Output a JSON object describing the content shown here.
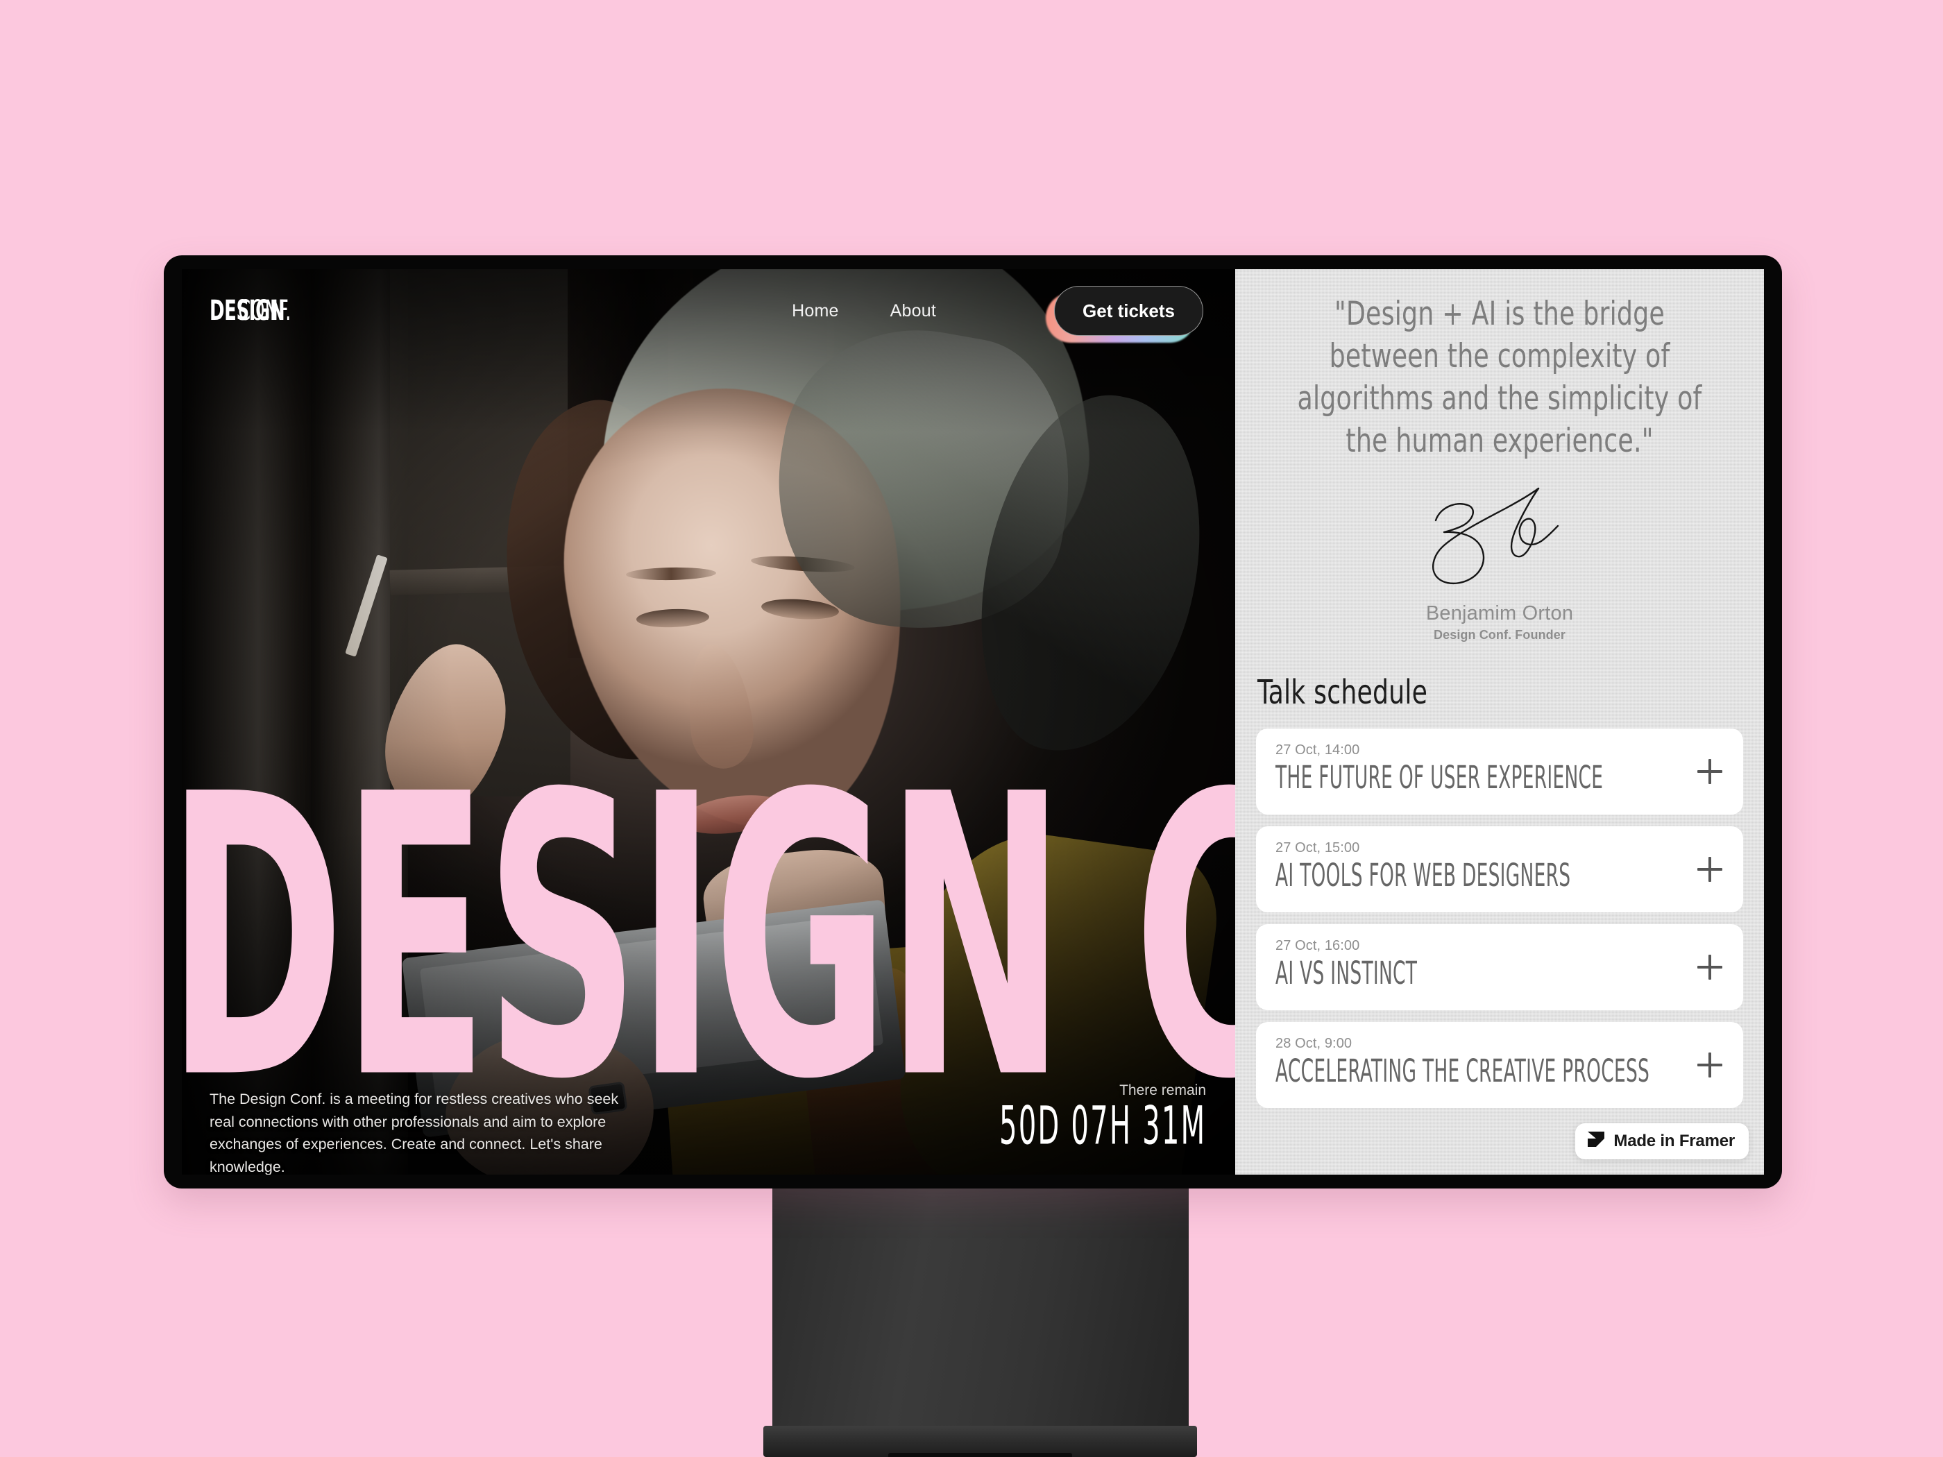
{
  "page": {
    "background_color": "#fcc8de",
    "accent_pink": "#fbc9e0",
    "panel_color": "#dfdfdf"
  },
  "hero": {
    "brand": {
      "bold_part": "DESIGN",
      "light_part": "CONF."
    },
    "nav": [
      {
        "label": "Home"
      },
      {
        "label": "About"
      }
    ],
    "cta": {
      "label": "Get tickets",
      "gradient": "#f58f7c → #c9a8e8 → #86dcc8"
    },
    "headline": "DESIGN CONF",
    "description": "The Design Conf. is a meeting for restless creatives who seek real connections with other professionals and aim to explore exchanges of experiences. Create and connect. Let's share knowledge.",
    "countdown": {
      "label": "There remain",
      "value": "50D 07H 31M"
    }
  },
  "panel": {
    "quote": "\"Design + AI is the bridge between the complexity of algorithms and the simplicity of the human experience.\"",
    "signature": {
      "name": "Benjamim Orton",
      "role": "Design Conf. Founder"
    },
    "schedule": {
      "title": "Talk schedule",
      "items": [
        {
          "date": "27 Oct, 14:00",
          "title": "THE FUTURE OF USER EXPERIENCE",
          "expand_icon": "plus-icon"
        },
        {
          "date": "27 Oct, 15:00",
          "title": "AI TOOLS FOR WEB DESIGNERS",
          "expand_icon": "plus-icon"
        },
        {
          "date": "27 Oct, 16:00",
          "title": "AI VS INSTINCT",
          "expand_icon": "plus-icon"
        },
        {
          "date": "28 Oct, 9:00",
          "title": "ACCELERATING THE CREATIVE PROCESS",
          "expand_icon": "plus-icon"
        }
      ]
    }
  },
  "badge": {
    "label": "Made in Framer",
    "icon": "framer-logo-icon"
  }
}
